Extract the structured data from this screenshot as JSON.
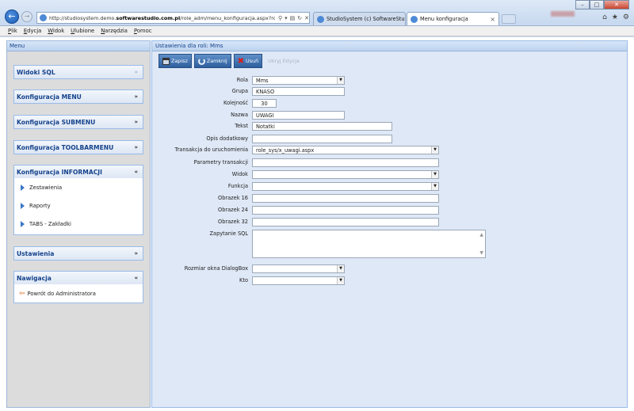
{
  "browser": {
    "url_plain": "http://studiosystem.demo.",
    "url_bold": "softwarestudio.com.pl",
    "url_rest": "/role_adm/menu_konfiguracja.aspx?rola=M",
    "tab_inactive": "StudioSystem (c) SoftwareStud...",
    "tab_active": "Menu konfiguracja",
    "menu": [
      "Plik",
      "Edycja",
      "Widok",
      "Ulubione",
      "Narzędzia",
      "Pomoc"
    ]
  },
  "left": {
    "title": "Menu",
    "panels": [
      {
        "title": "Widoki SQL",
        "chevron": "»"
      },
      {
        "title": "Konfiguracja MENU",
        "chevron": "»"
      },
      {
        "title": "Konfiguracja SUBMENU",
        "chevron": "»"
      },
      {
        "title": "Konfiguracja TOOLBARMENU",
        "chevron": "»"
      },
      {
        "title": "Konfiguracja INFORMACJI",
        "chevron": "«",
        "items": [
          "Zestawienia",
          "Raporty",
          "TABS - Zakładki"
        ]
      },
      {
        "title": "Ustawienia",
        "chevron": "»"
      },
      {
        "title": "Nawigacja",
        "chevron": "«",
        "items": [
          "Powrót do Administratora"
        ]
      }
    ]
  },
  "right": {
    "title": "Ustawienia dla roli: Mms",
    "toolbar": {
      "save": "Zapisz",
      "close": "Zamknij",
      "delete": "Usuń",
      "hide": "Ukryj Edycja"
    }
  },
  "form": {
    "rola": {
      "label": "Rola",
      "value": "Mms"
    },
    "grupa": {
      "label": "Grupa",
      "value": "KNASO"
    },
    "kolejnosc": {
      "label": "Kolejność",
      "value": "30"
    },
    "nazwa": {
      "label": "Nazwa",
      "value": "UWAGI"
    },
    "tekst": {
      "label": "Tekst",
      "value": "Notatki"
    },
    "opis": {
      "label": "Opis dodatkowy",
      "value": ""
    },
    "transakcja": {
      "label": "Transakcja do uruchomienia",
      "value": "role_sys/x_uwagi.aspx"
    },
    "parametry": {
      "label": "Parametry transakcji",
      "value": ""
    },
    "widok": {
      "label": "Widok",
      "value": ""
    },
    "funkcja": {
      "label": "Funkcja",
      "value": ""
    },
    "obrazek16": {
      "label": "Obrazek 16",
      "value": ""
    },
    "obrazek24": {
      "label": "Obrazek 24",
      "value": ""
    },
    "obrazek32": {
      "label": "Obrazek 32",
      "value": ""
    },
    "zapytanie": {
      "label": "Zapytanie SQL",
      "value": ""
    },
    "rozmiar": {
      "label": "Rozmiar okna DialogBox",
      "value": ""
    },
    "kto": {
      "label": "Kto",
      "value": ""
    }
  }
}
